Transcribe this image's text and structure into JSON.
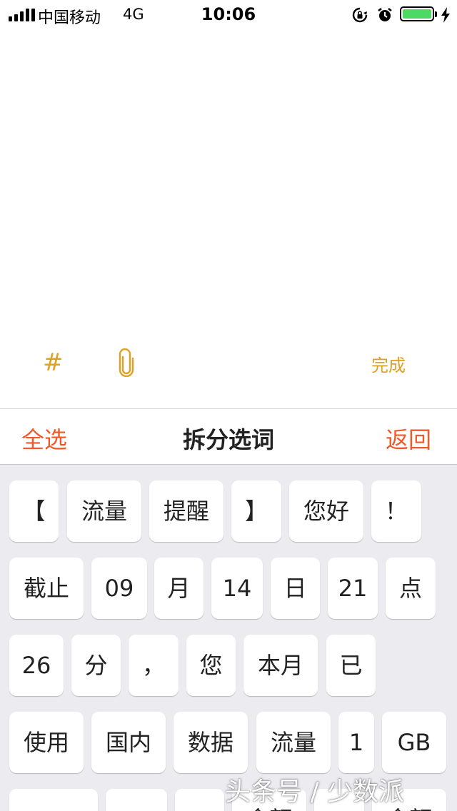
{
  "status_bar": {
    "carrier": "中国移动",
    "network": "4G",
    "time": "10:06",
    "battery_color": "#4cd964",
    "icons": [
      "signal-icon",
      "rotation-lock-icon",
      "alarm-icon",
      "battery-icon",
      "charging-icon"
    ]
  },
  "toolbar": {
    "tag_symbol": "#",
    "attach_icon": "paperclip-icon",
    "done_label": "完成",
    "accent_color": "#e0a020"
  },
  "split": {
    "select_all_label": "全选",
    "title": "拆分选词",
    "back_label": "返回",
    "accent_color": "#f05a28"
  },
  "words": [
    [
      "【",
      "流量",
      "提醒",
      "】",
      "您好",
      "！"
    ],
    [
      "截止",
      "09",
      "月",
      "14",
      "日",
      "21",
      "点"
    ],
    [
      "26",
      "分",
      "，",
      "您",
      "本月",
      "已"
    ],
    [
      "使用",
      "国内",
      "数据",
      "流量",
      "1",
      "GB"
    ],
    [
      "",
      "",
      "",
      "余额",
      "",
      "余额"
    ]
  ],
  "watermark": "头条号 / 少数派"
}
